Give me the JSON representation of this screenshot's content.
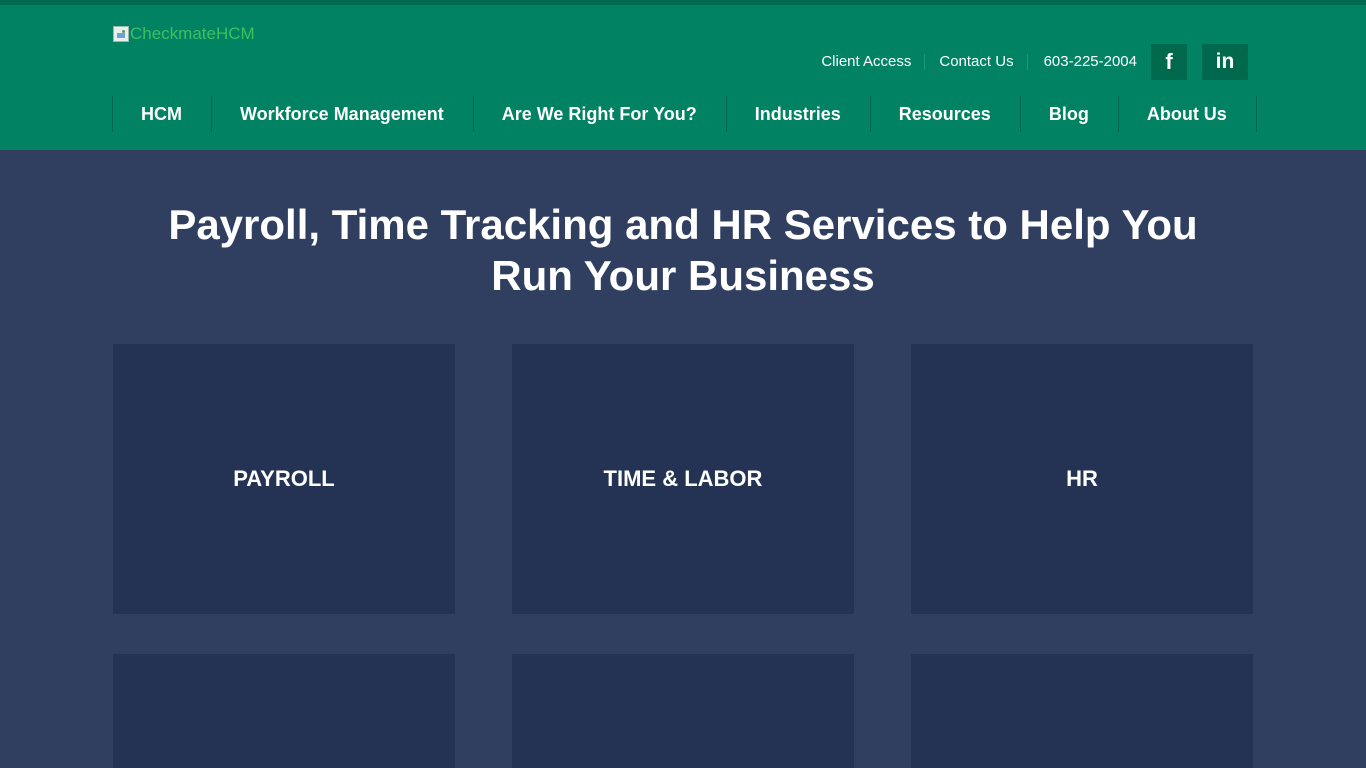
{
  "logo": {
    "alt": "CheckmateHCM"
  },
  "utility": {
    "client_access": "Client Access",
    "contact_us": "Contact Us",
    "phone": "603-225-2004",
    "facebook_glyph": "f",
    "linkedin_glyph": "in"
  },
  "nav": {
    "items": [
      {
        "label": "HCM"
      },
      {
        "label": "Workforce Management"
      },
      {
        "label": "Are We Right For You?"
      },
      {
        "label": "Industries"
      },
      {
        "label": "Resources"
      },
      {
        "label": "Blog"
      },
      {
        "label": "About Us"
      }
    ]
  },
  "hero": {
    "title_line1": "Payroll, Time Tracking and HR Services to Help You",
    "title_line2": "Run Your Business"
  },
  "tiles": [
    {
      "label": "PAYROLL"
    },
    {
      "label": "TIME & LABOR"
    },
    {
      "label": "HR"
    },
    {
      "label": ""
    },
    {
      "label": ""
    },
    {
      "label": ""
    }
  ],
  "colors": {
    "header_green": "#008263",
    "dark_green": "#006a4e",
    "page_bg": "#303f60",
    "tile_bg": "#243354",
    "logo_alt_text": "#3fbf5f"
  },
  "icons": [
    "broken-image-icon",
    "facebook-icon",
    "linkedin-icon"
  ]
}
